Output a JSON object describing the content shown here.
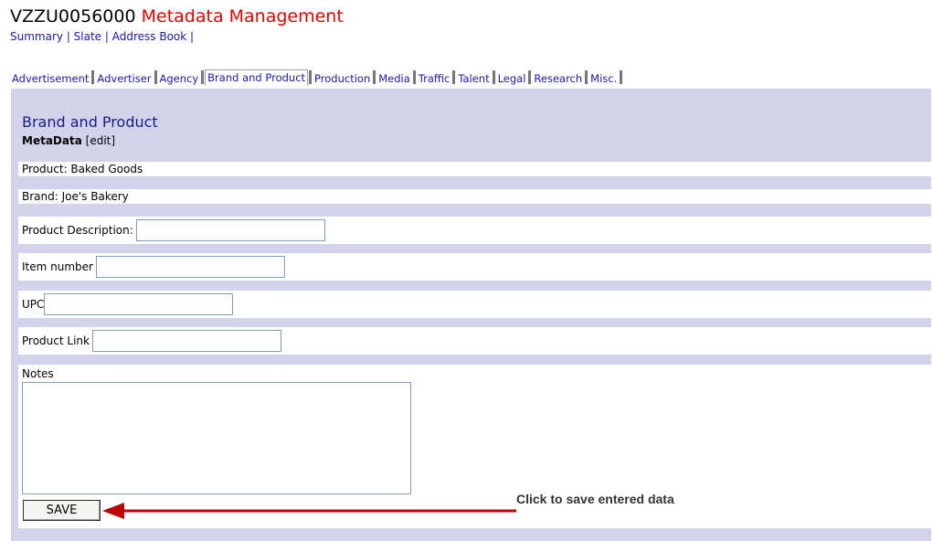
{
  "header": {
    "code": "VZZU0056000",
    "title": "Metadata Management"
  },
  "toplinks": [
    {
      "label": "Summary",
      "sep": " | "
    },
    {
      "label": "Slate",
      "sep": " | "
    },
    {
      "label": "Address Book",
      "sep": " |"
    }
  ],
  "tabs": [
    "Advertisement",
    "Advertiser",
    "Agency",
    "Brand and Product",
    "Production",
    "Media",
    "Traffic",
    "Talent",
    "Legal",
    "Research",
    "Misc."
  ],
  "active_tab": "Brand and Product",
  "panel": {
    "title": "Brand and Product",
    "meta_label": "MetaData",
    "edit_link": "[edit]",
    "product": "Product: Baked Goods",
    "brand": "Brand: Joe's Bakery",
    "fields": {
      "product_description": {
        "label": "Product Description:",
        "value": ""
      },
      "item_number": {
        "label": "Item number",
        "value": ""
      },
      "upc": {
        "label": "UPC",
        "value": ""
      },
      "product_link": {
        "label": "Product Link",
        "value": ""
      }
    },
    "notes_label": "Notes",
    "notes_value": "",
    "save_label": "SAVE"
  },
  "annotation": {
    "text": "Click to save entered data",
    "arrow_color": "#c00000"
  },
  "colors": {
    "panel_bg": "#d2d2ea",
    "title_red": "#e00000",
    "link_blue": "#1a1aa6",
    "heading_blue": "#1b1b8a"
  }
}
